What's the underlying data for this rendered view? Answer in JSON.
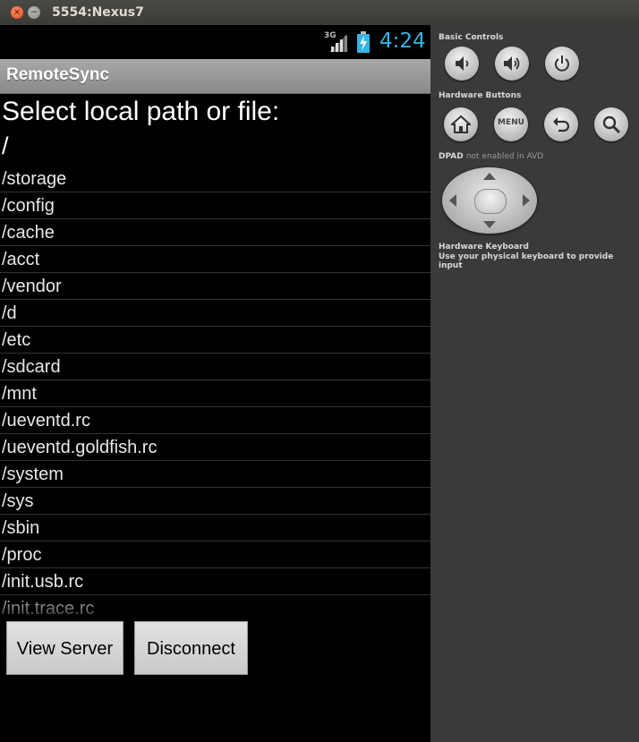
{
  "window": {
    "title": "5554:Nexus7",
    "close_glyph": "×",
    "min_glyph": "−"
  },
  "status_bar": {
    "network": "3G",
    "clock": "4:24",
    "clock_color": "#33b5e5"
  },
  "app": {
    "title": "RemoteSync",
    "prompt": "Select local path or file:",
    "current_path": "/",
    "files": [
      "/storage",
      "/config",
      "/cache",
      "/acct",
      "/vendor",
      "/d",
      "/etc",
      "/sdcard",
      "/mnt",
      "/ueventd.rc",
      "/ueventd.goldfish.rc",
      "/system",
      "/sys",
      "/sbin",
      "/proc",
      "/init.usb.rc",
      "/init.trace.rc"
    ],
    "buttons": {
      "view_server": "View Server",
      "disconnect": "Disconnect"
    }
  },
  "controls": {
    "basic_controls_label": "Basic Controls",
    "basic_buttons": [
      "volume-down-icon",
      "volume-up-icon",
      "power-icon"
    ],
    "hardware_buttons_label": "Hardware Buttons",
    "hardware_buttons": [
      "home-icon",
      "menu",
      "back-icon",
      "search-icon"
    ],
    "menu_label": "MENU",
    "dpad_label": "DPAD",
    "dpad_note": "not enabled in AVD",
    "keyboard_label": "Hardware Keyboard",
    "keyboard_note": "Use your physical keyboard to provide input"
  }
}
